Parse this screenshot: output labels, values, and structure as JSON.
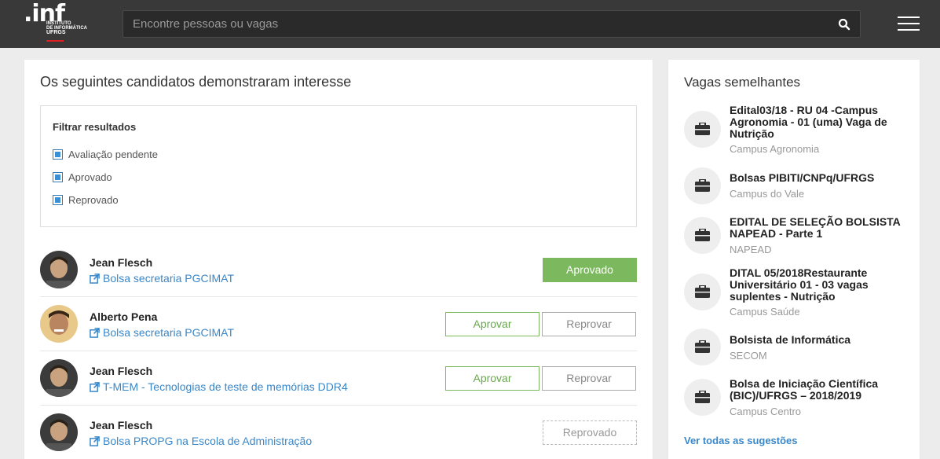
{
  "header": {
    "logo_text": ".inf",
    "logo_line1": "INSTITUTO",
    "logo_line2": "DE INFORMÁTICA",
    "logo_line3": "UFRGS",
    "search_placeholder": "Encontre pessoas ou vagas",
    "search_icon": "search-icon",
    "menu_icon": "hamburger-menu-icon"
  },
  "main": {
    "title": "Os seguintes candidatos demonstraram interesse",
    "filter": {
      "title": "Filtrar resultados",
      "options": [
        {
          "label": "Avaliação pendente",
          "checked": true
        },
        {
          "label": "Aprovado",
          "checked": true
        },
        {
          "label": "Reprovado",
          "checked": true
        }
      ]
    },
    "candidates": [
      {
        "name": "Jean Flesch",
        "job": "Bolsa secretaria PGCIMAT",
        "status": "approved",
        "status_label": "Aprovado"
      },
      {
        "name": "Alberto Pena",
        "job": "Bolsa secretaria PGCIMAT",
        "status": "pending",
        "approve_label": "Aprovar",
        "reject_label": "Reprovar"
      },
      {
        "name": "Jean Flesch",
        "job": "T-MEM - Tecnologias de teste de memórias DDR4",
        "status": "pending",
        "approve_label": "Aprovar",
        "reject_label": "Reprovar"
      },
      {
        "name": "Jean Flesch",
        "job": "Bolsa PROPG na Escola de Administração",
        "status": "rejected",
        "status_label": "Reprovado"
      }
    ]
  },
  "sidebar": {
    "title": "Vagas semelhantes",
    "items": [
      {
        "title": "Edital03/18 - RU 04 -Campus Agronomia - 01 (uma) Vaga de Nutrição",
        "location": "Campus Agronomia"
      },
      {
        "title": "Bolsas PIBITI/CNPq/UFRGS",
        "location": "Campus do Vale"
      },
      {
        "title": "EDITAL DE SELEÇÃO BOLSISTA NAPEAD - Parte 1",
        "location": "NAPEAD"
      },
      {
        "title": "DITAL 05/2018Restaurante Universitário 01 - 03 vagas suplentes - Nutrição",
        "location": "Campus Saúde"
      },
      {
        "title": "Bolsista de Informática",
        "location": "SECOM"
      },
      {
        "title": "Bolsa de Iniciação Científica (BIC)/UFRGS – 2018/2019",
        "location": "Campus Centro"
      }
    ],
    "see_all": "Ver todas as sugestões"
  },
  "colors": {
    "topbar": "#393939",
    "approved": "#7cb85e",
    "link": "#3a87c8",
    "brand_red": "#e02020"
  }
}
